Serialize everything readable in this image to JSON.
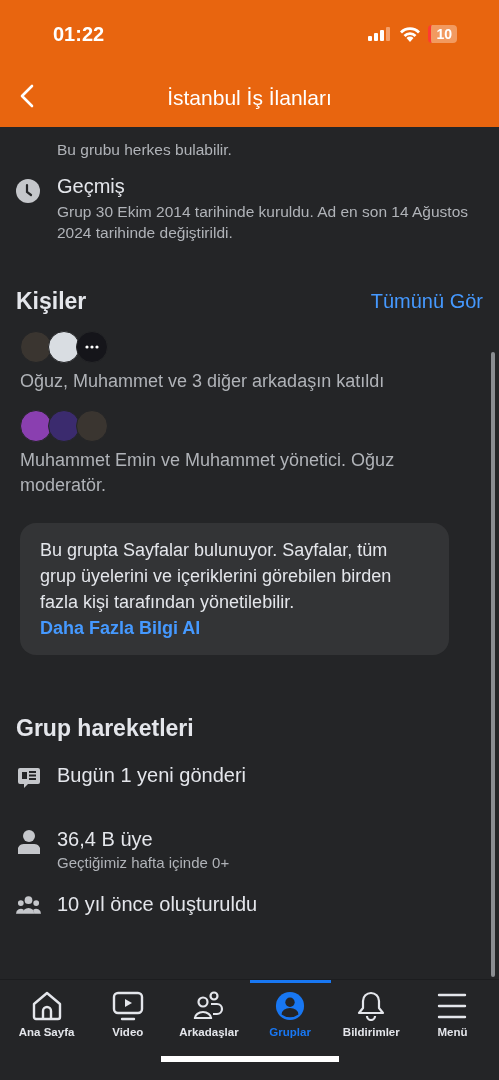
{
  "status_bar": {
    "time": "01:22",
    "battery": "10"
  },
  "header": {
    "title": "İstanbul İş İlanları"
  },
  "about": [
    {
      "kind": "visibility",
      "description": "Bu grubu herkes bulabilir."
    },
    {
      "kind": "history",
      "title": "Geçmiş",
      "description": "Grup 30 Ekim 2014 tarihinde kuruldu. Ad en son 14 Ağustos 2024 tarihinde değiştirildi."
    }
  ],
  "people": {
    "title": "Kişiler",
    "see_all": "Tümünü Gör",
    "groups": [
      {
        "avatars": [
          {
            "color": "#3a3530"
          },
          {
            "color": "#d9dde2"
          },
          {
            "color": "#15151a",
            "more": true
          }
        ],
        "text": "Oğuz, Muhammet ve 3 diğer arkadaşın katıldı"
      },
      {
        "avatars": [
          {
            "color": "#8a3fb0"
          },
          {
            "color": "#3b2b6e"
          },
          {
            "color": "#3a3530"
          }
        ],
        "text": "Muhammet Emin ve Muhammet yönetici. Oğuz moderatör."
      }
    ],
    "notice": {
      "text": "Bu grupta Sayfalar bulunuyor. Sayfalar, tüm grup üyelerini ve içeriklerini görebilen birden fazla kişi tarafından yönetilebilir.",
      "link": "Daha Fazla Bilgi Al"
    }
  },
  "activity": {
    "title": "Grup hareketleri",
    "items": [
      {
        "kind": "posts",
        "text": "Bugün 1 yeni gönderi"
      },
      {
        "kind": "members",
        "text": "36,4 B üye",
        "subtext": "Geçtiğimiz hafta içinde 0+"
      },
      {
        "kind": "created",
        "text": "10 yıl önce oluşturuldu"
      }
    ]
  },
  "tabs": [
    {
      "kind": "home",
      "label": "Ana Sayfa",
      "selected": false
    },
    {
      "kind": "video",
      "label": "Video",
      "selected": false
    },
    {
      "kind": "friends",
      "label": "Arkadaşlar",
      "selected": false
    },
    {
      "kind": "groups",
      "label": "Gruplar",
      "selected": true
    },
    {
      "kind": "bell",
      "label": "Bildirimler",
      "selected": false
    },
    {
      "kind": "menu",
      "label": "Menü",
      "selected": false
    }
  ]
}
